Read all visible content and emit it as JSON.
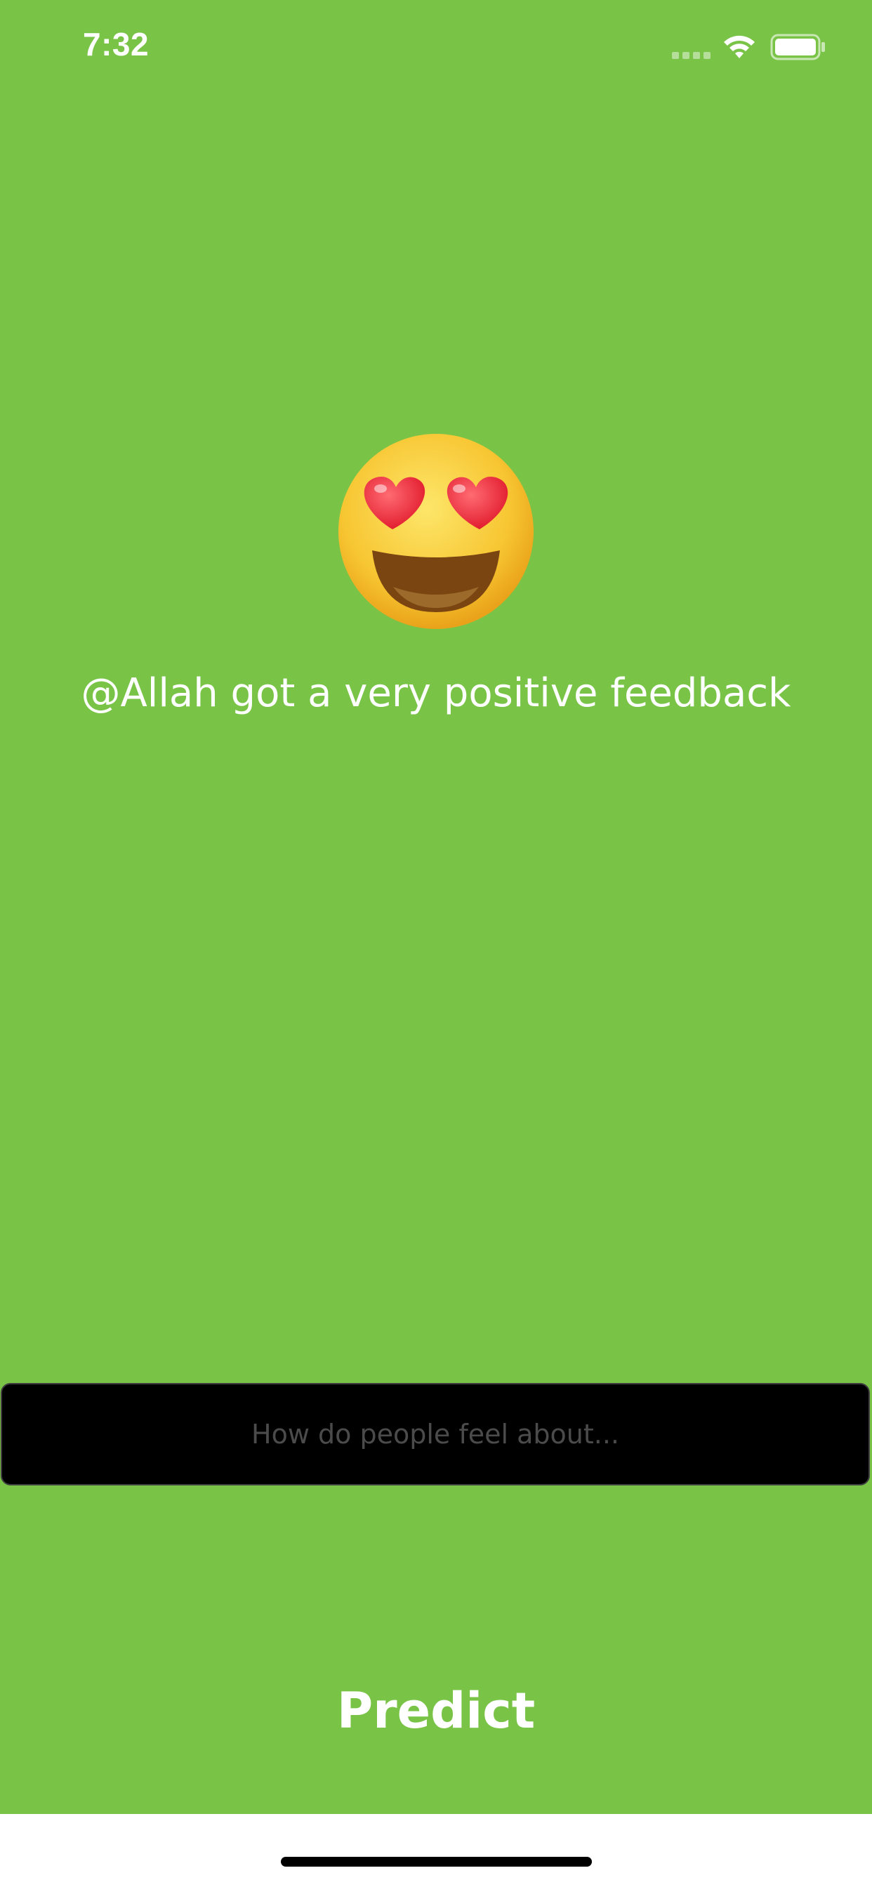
{
  "status_bar": {
    "time": "7:32",
    "icons": [
      "signal-icon",
      "wifi-icon",
      "battery-icon"
    ]
  },
  "result": {
    "emoji": "smiling-face-with-heart-eyes-icon",
    "message": "@Allah got a very positive feedback"
  },
  "search": {
    "value": "",
    "placeholder": "How do people feel about..."
  },
  "actions": {
    "predict_label": "Predict"
  },
  "colors": {
    "background": "#79c447",
    "input_background": "#000000",
    "text": "#ffffff",
    "placeholder": "#4b4b4b",
    "bottom_area": "#ffffff",
    "home_indicator": "#000000"
  }
}
